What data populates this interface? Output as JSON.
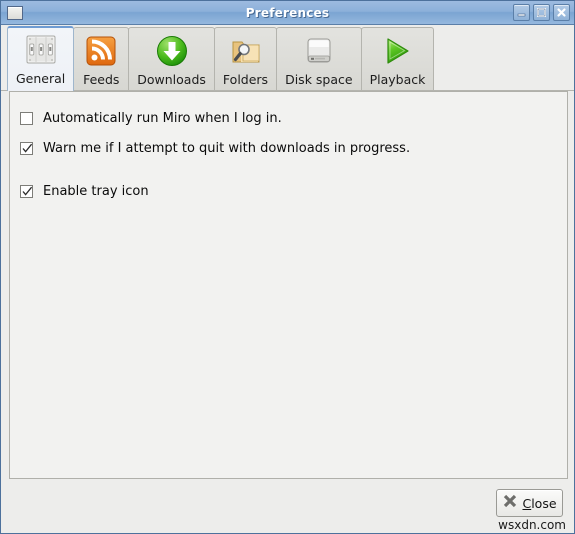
{
  "window": {
    "title": "Preferences",
    "icon": "window-icon",
    "controls": [
      {
        "name": "minimize-button",
        "glyph": "minimize"
      },
      {
        "name": "maximize-button",
        "glyph": "maximize"
      },
      {
        "name": "close-window-button",
        "glyph": "close"
      }
    ]
  },
  "tabs": [
    {
      "label": "General",
      "icon": "light-switch-icon",
      "active": true
    },
    {
      "label": "Feeds",
      "icon": "rss-feed-icon",
      "active": false
    },
    {
      "label": "Downloads",
      "icon": "download-arrow-icon",
      "active": false
    },
    {
      "label": "Folders",
      "icon": "folder-search-icon",
      "active": false
    },
    {
      "label": "Disk space",
      "icon": "hard-drive-icon",
      "active": false
    },
    {
      "label": "Playback",
      "icon": "play-triangle-icon",
      "active": false
    }
  ],
  "general": {
    "options": [
      {
        "label": "Automatically run Miro when I log in.",
        "checked": false
      },
      {
        "label": "Warn me if I attempt to quit with downloads in progress.",
        "checked": true
      },
      {
        "label": "Enable tray icon",
        "checked": true
      }
    ]
  },
  "footer": {
    "close_button": {
      "label_prefix": "",
      "accel": "C",
      "label_rest": "lose",
      "icon": "x-mark-icon"
    },
    "watermark": "wsxdn.com"
  },
  "colors": {
    "titlebar_blue": "#8cb0da",
    "accent_tab_top": "#6e9bd2",
    "panel_bg": "#f2f2f0",
    "chrome_bg": "#ededeb",
    "feeds_orange": "#e9711c",
    "downloads_green": "#35a614",
    "folder_tan": "#efcf8c",
    "play_green": "#4cc216"
  }
}
